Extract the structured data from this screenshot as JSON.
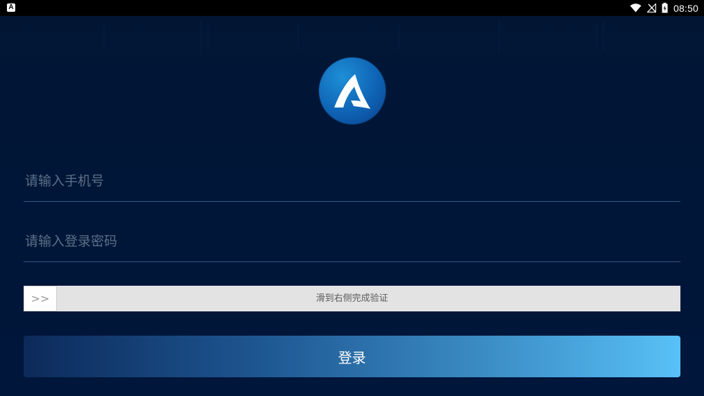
{
  "status_bar": {
    "app_icon_glyph": "A",
    "time": "08:50",
    "icons": [
      "wifi-icon",
      "no-signal-icon",
      "battery-charging-icon"
    ]
  },
  "login": {
    "phone_placeholder": "请输入手机号",
    "password_placeholder": "请输入登录密码",
    "slider_handle_glyph": ">>",
    "slider_text": "滑到右侧完成验证",
    "login_button_label": "登录"
  },
  "colors": {
    "background": "#001638",
    "login_button_gradient_start": "#0c2a5a",
    "login_button_gradient_end": "#58c1f7",
    "slider_track": "#e3e3e3",
    "logo_blue": "#0f63b4"
  },
  "logo_icon": "brand-logo-icon"
}
